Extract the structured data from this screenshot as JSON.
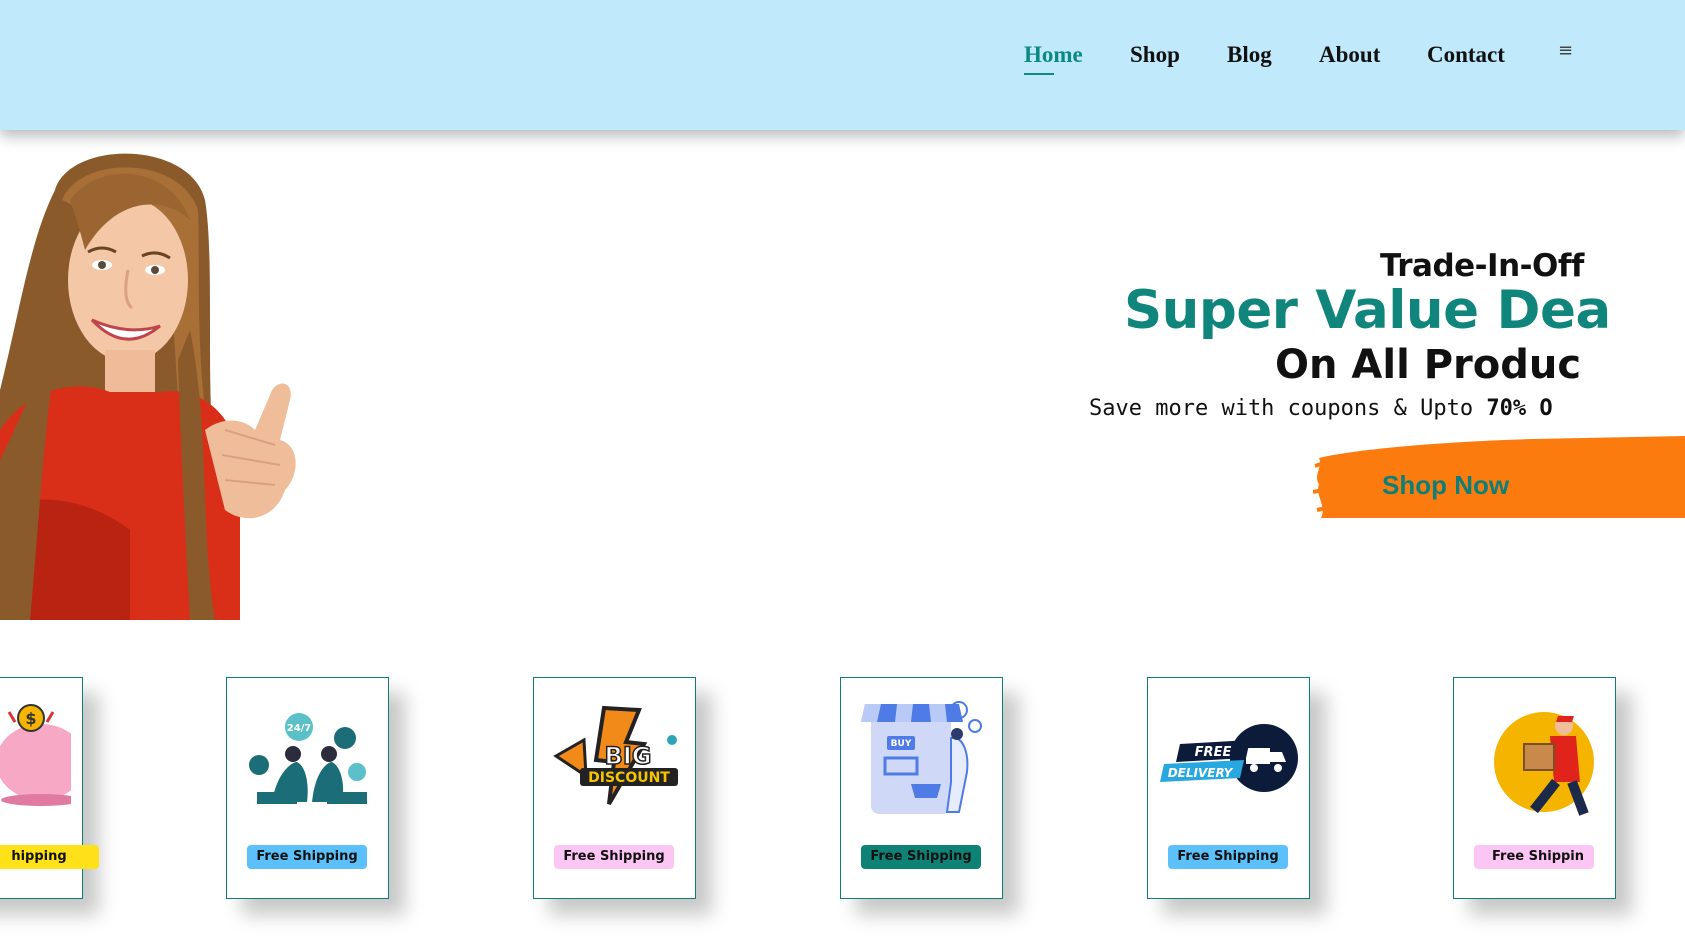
{
  "nav": {
    "items": [
      {
        "label": "Home",
        "active": true
      },
      {
        "label": "Shop",
        "active": false
      },
      {
        "label": "Blog",
        "active": false
      },
      {
        "label": "About",
        "active": false
      },
      {
        "label": "Contact",
        "active": false
      }
    ],
    "cart_icon": "cart-icon"
  },
  "hero": {
    "kicker": "Trade-In-Off",
    "headline": "Super Value Dea",
    "subheadline": "On All Produc",
    "tagline_prefix": "Save more with coupons & Upto",
    "tagline_bold": "70% O",
    "cta_label": "Shop Now",
    "image": "smiling-woman-thumbs-up"
  },
  "cards": [
    {
      "badge": "hipping",
      "badge_color": "#ffe11a",
      "icon": "piggy-bank-icon"
    },
    {
      "badge": "Free Shipping",
      "badge_color": "#5cc1fa",
      "icon": "support-247-icon"
    },
    {
      "badge": "Free Shipping",
      "badge_color": "#fcc6f4",
      "icon": "big-discount-icon"
    },
    {
      "badge": "Free Shipping",
      "badge_color": "#0f8276",
      "icon": "online-shop-icon"
    },
    {
      "badge": "Free Shipping",
      "badge_color": "#5cc1fa",
      "icon": "free-delivery-icon"
    },
    {
      "badge": "Free Shippin",
      "badge_color": "#fcc6f4",
      "icon": "delivery-man-icon"
    }
  ],
  "colors": {
    "header_bg": "#c0e9fc",
    "accent_teal": "#0f857b",
    "cta_orange": "#fb7b0f"
  }
}
